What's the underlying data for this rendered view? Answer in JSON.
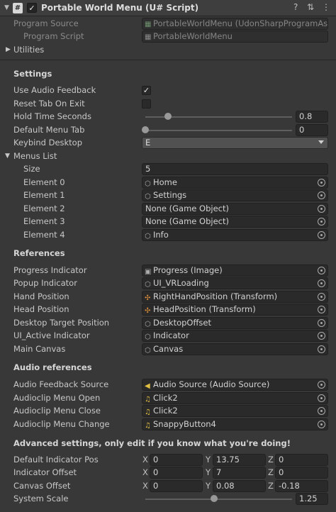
{
  "header": {
    "title": "Portable World Menu (U# Script)",
    "script_icon": "#",
    "help_icon": "?",
    "settings_icon": "⇅",
    "menu_icon": "⋮"
  },
  "script_info": {
    "program_source_label": "Program Source",
    "program_source_value": "PortableWorldMenu (UdonSharpProgramAsse",
    "program_script_label": "Program Script",
    "program_script_value": "PortableWorldMenu"
  },
  "utilities_label": "Utilities",
  "settings": {
    "heading": "Settings",
    "use_audio_feedback_label": "Use Audio Feedback",
    "use_audio_feedback": true,
    "reset_tab_on_exit_label": "Reset Tab On Exit",
    "reset_tab_on_exit": false,
    "hold_time_seconds_label": "Hold Time Seconds",
    "hold_time_seconds": "0.8",
    "default_menu_tab_label": "Default Menu Tab",
    "default_menu_tab": "0",
    "keybind_desktop_label": "Keybind Desktop",
    "keybind_desktop": "E"
  },
  "menus_list": {
    "label": "Menus List",
    "size_label": "Size",
    "size": "5",
    "elements": [
      {
        "label": "Element 0",
        "value": "Home",
        "icon": "cube-icon"
      },
      {
        "label": "Element 1",
        "value": "Settings",
        "icon": "cube-icon"
      },
      {
        "label": "Element 2",
        "value": "None (Game Object)",
        "icon": ""
      },
      {
        "label": "Element 3",
        "value": "None (Game Object)",
        "icon": ""
      },
      {
        "label": "Element 4",
        "value": "Info",
        "icon": "cube-icon"
      }
    ]
  },
  "references": {
    "heading": "References",
    "items": [
      {
        "label": "Progress Indicator",
        "value": "Progress (Image)",
        "icon": "image-icon"
      },
      {
        "label": "Popup Indicator",
        "value": "UI_VRLoading",
        "icon": "cube-icon"
      },
      {
        "label": "Hand Position",
        "value": "RightHandPosition (Transform)",
        "icon": "transform-icon"
      },
      {
        "label": "Head Position",
        "value": "HeadPosition (Transform)",
        "icon": "transform-icon"
      },
      {
        "label": "Desktop Target Position",
        "value": "DesktopOffset",
        "icon": "cube-icon"
      },
      {
        "label": "UI_Active Indicator",
        "value": "Indicator",
        "icon": "cube-icon"
      },
      {
        "label": "Main Canvas",
        "value": "Canvas",
        "icon": "cube-icon"
      }
    ]
  },
  "audio_references": {
    "heading": "Audio references",
    "items": [
      {
        "label": "Audio Feedback Source",
        "value": "Audio Source (Audio Source)",
        "icon": "speaker-icon"
      },
      {
        "label": "Audioclip Menu Open",
        "value": "Click2",
        "icon": "music-note-icon"
      },
      {
        "label": "Audioclip Menu Close",
        "value": "Click2",
        "icon": "music-note-icon"
      },
      {
        "label": "Audioclip Menu Change",
        "value": "SnappyButton4",
        "icon": "music-note-icon"
      }
    ]
  },
  "advanced": {
    "heading": "Advanced settings, only edit if you know what you're doing!",
    "vector_rows": [
      {
        "label": "Default Indicator Pos",
        "x": "0",
        "y": "13.75",
        "z": "0"
      },
      {
        "label": "Indicator Offset",
        "x": "0",
        "y": "7",
        "z": "0"
      },
      {
        "label": "Canvas Offset",
        "x": "0",
        "y": "0.08",
        "z": "-0.18"
      }
    ],
    "axis_labels": {
      "x": "X",
      "y": "Y",
      "z": "Z"
    },
    "system_scale_label": "System Scale",
    "system_scale": "1.25"
  },
  "icons": {
    "cube-icon": "⬡",
    "image-icon": "▣",
    "transform-icon": "✣",
    "speaker-icon": "◀",
    "music-note-icon": "♫",
    "script-file-icon": "▦"
  }
}
